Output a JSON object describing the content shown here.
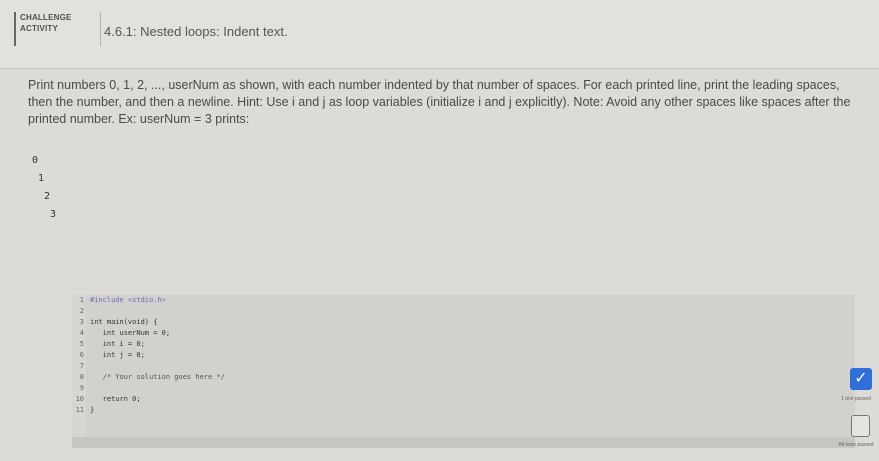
{
  "header": {
    "badge_line1": "CHALLENGE",
    "badge_line2": "ACTIVITY",
    "title": "4.6.1: Nested loops: Indent text."
  },
  "prompt": {
    "text": "Print numbers 0, 1, 2, ..., userNum as shown, with each number indented by that number of spaces. For each printed line, print the leading spaces, then the number, and then a newline. Hint: Use i and j as loop variables (initialize i and j explicitly). Note: Avoid any other spaces like spaces after the printed number. Ex: userNum = 3 prints:"
  },
  "output": [
    "0",
    " 1",
    "  2",
    "   3"
  ],
  "code": [
    {
      "n": "1",
      "t": "#include <stdio.h>"
    },
    {
      "n": "2",
      "t": ""
    },
    {
      "n": "3",
      "t": "int main(void) {"
    },
    {
      "n": "4",
      "t": "   int userNum = 0;"
    },
    {
      "n": "5",
      "t": "   int i = 0;"
    },
    {
      "n": "6",
      "t": "   int j = 0;"
    },
    {
      "n": "7",
      "t": ""
    },
    {
      "n": "8",
      "t": "   /* Your solution goes here */"
    },
    {
      "n": "9",
      "t": ""
    },
    {
      "n": "10",
      "t": "   return 0;"
    },
    {
      "n": "11",
      "t": "}"
    }
  ],
  "status": {
    "passed_label": "1 test passed",
    "all_label": "All tests passed",
    "check_icon": "check-icon"
  }
}
